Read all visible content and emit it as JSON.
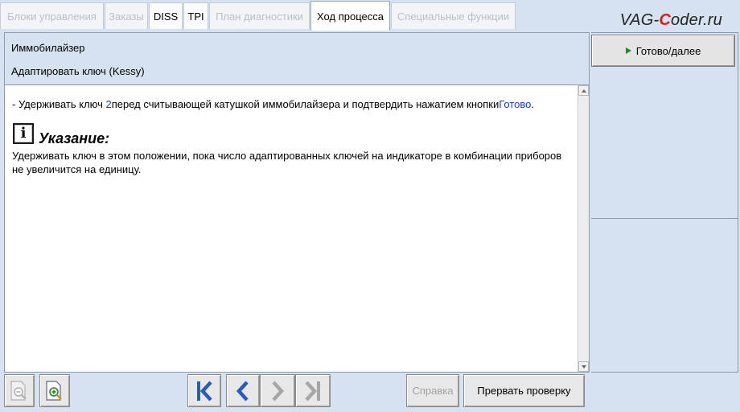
{
  "tabs": [
    {
      "label": "Блоки управления",
      "state": "disabled"
    },
    {
      "label": "Заказы",
      "state": "disabled"
    },
    {
      "label": "DISS",
      "state": "enabled"
    },
    {
      "label": "TPI",
      "state": "enabled"
    },
    {
      "label": "План диагностики",
      "state": "disabled"
    },
    {
      "label": "Ход процесса",
      "state": "active"
    },
    {
      "label": "Специальные функции",
      "state": "disabled"
    }
  ],
  "brand": {
    "before": "VAG-",
    "accent": "C",
    "after": "oder.ru"
  },
  "header": {
    "line1": "Иммобилайзер",
    "line2": "Адаптировать ключ (Kessy)"
  },
  "content": {
    "instruction_prefix": "- Удерживать ключ ",
    "instruction_key_number": "2",
    "instruction_middle": "перед считывающей катушкой иммобилайзера и подтвердить нажатием кнопки",
    "instruction_link": "Готово",
    "instruction_suffix": ".",
    "note_icon_glyph": "i",
    "note_title": "Указание:",
    "note_text": "Удерживать ключ в этом положении, пока число адаптированных ключей на индикаторе в комбинации приборов не увеличится на единицу."
  },
  "right_panel": {
    "ready_button_label": "Готово/далее"
  },
  "toolbar": {
    "help_label": "Справка",
    "abort_label": "Прервать проверку"
  },
  "colors": {
    "background": "#d6e2f0",
    "nav_blue": "#2a5bb8",
    "nav_disabled": "#a6a6a6",
    "play_green": "#1e8a24",
    "link_blue": "#1a3fc4",
    "brand_red": "#d21f1f"
  },
  "icons": {
    "zoom_out": "zoom-out-icon",
    "zoom_in": "zoom-in-icon",
    "first": "skip-first-icon",
    "prev": "chevron-left-icon",
    "next": "chevron-right-icon",
    "last": "skip-last-icon",
    "info": "info-icon",
    "play": "play-icon"
  }
}
